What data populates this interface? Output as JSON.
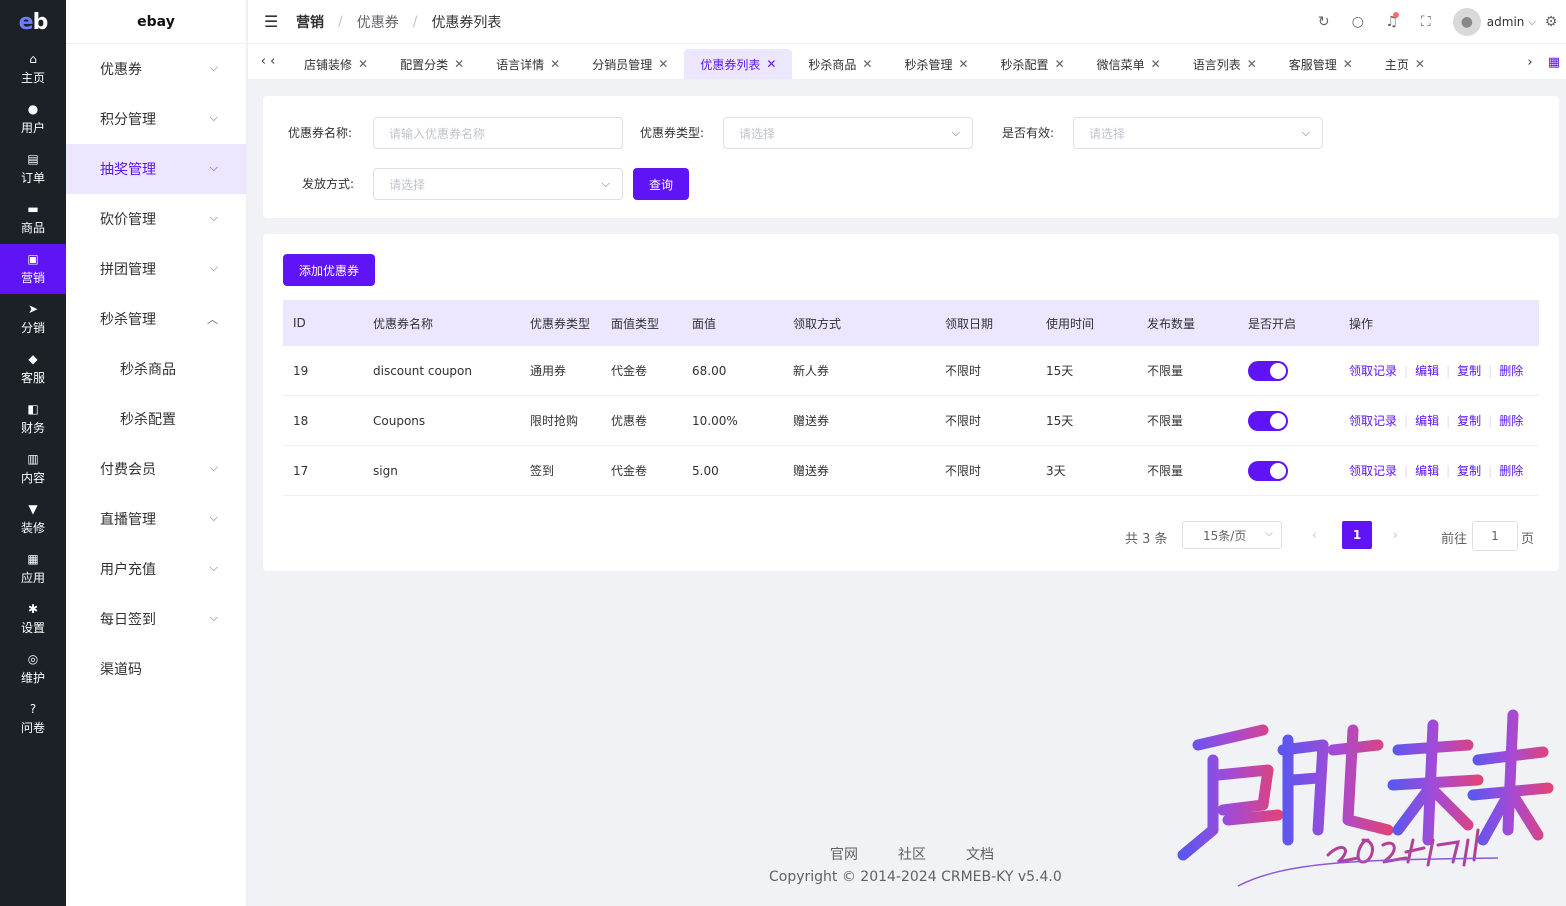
{
  "rail": {
    "items": [
      {
        "label": "主页",
        "icon": "home-icon",
        "glyph": "⌂"
      },
      {
        "label": "用户",
        "icon": "user-icon",
        "glyph": "●"
      },
      {
        "label": "订单",
        "icon": "order-icon",
        "glyph": "▤"
      },
      {
        "label": "商品",
        "icon": "goods-icon",
        "glyph": "▬"
      },
      {
        "label": "营销",
        "icon": "marketing-icon",
        "glyph": "▣"
      },
      {
        "label": "分销",
        "icon": "distribution-icon",
        "glyph": "➤"
      },
      {
        "label": "客服",
        "icon": "service-icon",
        "glyph": "◆"
      },
      {
        "label": "财务",
        "icon": "finance-icon",
        "glyph": "◧"
      },
      {
        "label": "内容",
        "icon": "content-icon",
        "glyph": "▥"
      },
      {
        "label": "装修",
        "icon": "decoration-icon",
        "glyph": "▼"
      },
      {
        "label": "应用",
        "icon": "apps-icon",
        "glyph": "▦"
      },
      {
        "label": "设置",
        "icon": "settings-icon",
        "glyph": "✱"
      },
      {
        "label": "维护",
        "icon": "maintenance-icon",
        "glyph": "◎"
      },
      {
        "label": "问卷",
        "icon": "question-icon",
        "glyph": "?"
      }
    ]
  },
  "submenu": {
    "brand": "ebay",
    "items": [
      {
        "label": "优惠券"
      },
      {
        "label": "积分管理"
      },
      {
        "label": "抽奖管理"
      },
      {
        "label": "砍价管理"
      },
      {
        "label": "拼团管理"
      },
      {
        "label": "秒杀管理"
      },
      {
        "label": "秒杀商品"
      },
      {
        "label": "秒杀配置"
      },
      {
        "label": "付费会员"
      },
      {
        "label": "直播管理"
      },
      {
        "label": "用户充值"
      },
      {
        "label": "每日签到"
      },
      {
        "label": "渠道码"
      }
    ]
  },
  "header": {
    "breadcrumb": [
      "营销",
      "优惠券",
      "优惠券列表"
    ],
    "username": "admin"
  },
  "tabs": [
    "店铺装修",
    "配置分类",
    "语言详情",
    "分销员管理",
    "优惠券列表",
    "秒杀商品",
    "秒杀管理",
    "秒杀配置",
    "微信菜单",
    "语言列表",
    "客服管理",
    "主页"
  ],
  "filter": {
    "name_label": "优惠券名称:",
    "name_placeholder": "请输入优惠券名称",
    "type_label": "优惠券类型:",
    "type_placeholder": "请选择",
    "valid_label": "是否有效:",
    "valid_placeholder": "请选择",
    "issue_label": "发放方式:",
    "issue_placeholder": "请选择",
    "query_button": "查询"
  },
  "table": {
    "add_button": "添加优惠券",
    "columns": [
      "ID",
      "优惠券名称",
      "优惠券类型",
      "面值类型",
      "面值",
      "领取方式",
      "领取日期",
      "使用时间",
      "发布数量",
      "是否开启",
      "操作"
    ],
    "rows": [
      {
        "id": "19",
        "name": "discount coupon",
        "type": "通用券",
        "value_type": "代金卷",
        "value": "68.00",
        "receive": "新人券",
        "date": "不限时",
        "use_time": "15天",
        "count": "不限量",
        "enabled": true
      },
      {
        "id": "18",
        "name": "Coupons",
        "type": "限时抢购",
        "value_type": "优惠卷",
        "value": "10.00%",
        "receive": "赠送券",
        "date": "不限时",
        "use_time": "15天",
        "count": "不限量",
        "enabled": true
      },
      {
        "id": "17",
        "name": "sign",
        "type": "签到",
        "value_type": "代金卷",
        "value": "5.00",
        "receive": "赠送券",
        "date": "不限时",
        "use_time": "3天",
        "count": "不限量",
        "enabled": true
      }
    ],
    "actions": {
      "records": "领取记录",
      "edit": "编辑",
      "copy": "复制",
      "delete": "删除"
    }
  },
  "pagination": {
    "total": "共 3 条",
    "page_size": "15条/页",
    "current": "1",
    "goto_label": "前往",
    "goto_value": "1",
    "page_unit": "页"
  },
  "footer": {
    "links": [
      "官网",
      "社区",
      "文档"
    ],
    "copyright": "Copyright © 2014-2024 CRMEB-KY v5.4.0"
  },
  "colors": {
    "accent": "#5e14f5",
    "rail_bg": "#1c2027",
    "accent_light": "#ece7ff"
  }
}
